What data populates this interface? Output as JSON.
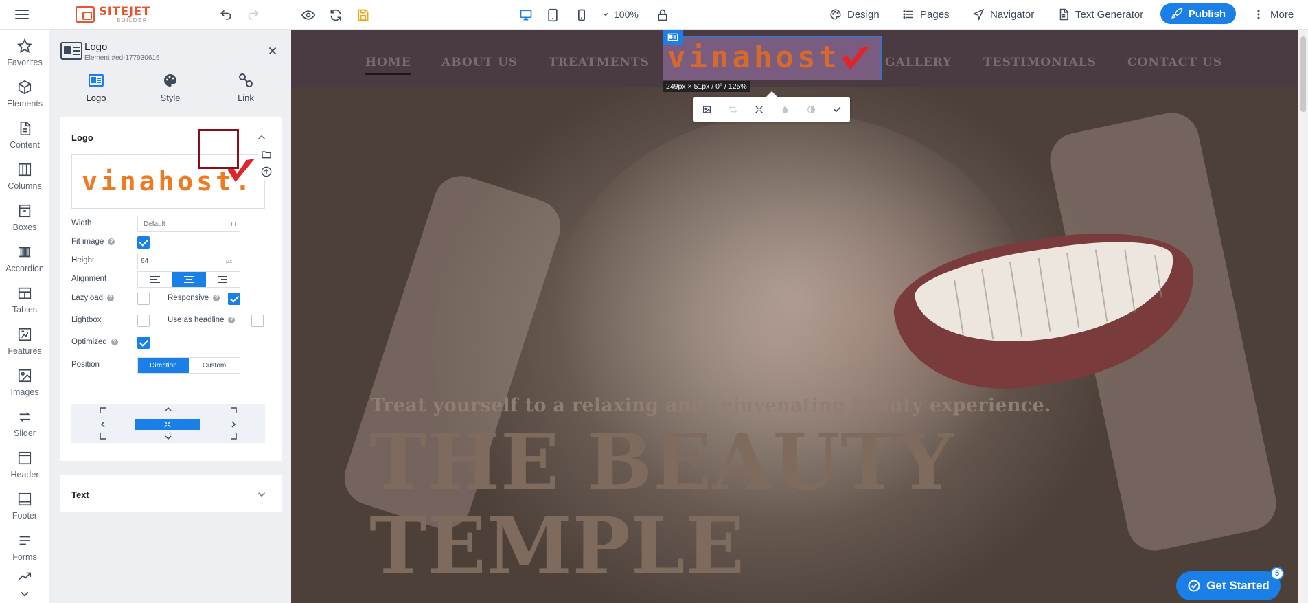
{
  "app": {
    "brand_line1": "SITEJET",
    "brand_line2": "BUILDER",
    "zoom": "100%",
    "nav": {
      "design": "Design",
      "pages": "Pages",
      "navigator": "Navigator",
      "text_generator": "Text Generator",
      "more": "More"
    },
    "publish_label": "Publish",
    "accent_color": "#1a7fe6",
    "brand_color": "#e8542c"
  },
  "rail": {
    "items": [
      {
        "label": "Favorites",
        "icon": "star-icon"
      },
      {
        "label": "Elements",
        "icon": "cube-icon"
      },
      {
        "label": "Content",
        "icon": "document-icon"
      },
      {
        "label": "Columns",
        "icon": "columns-icon"
      },
      {
        "label": "Boxes",
        "icon": "box-icon"
      },
      {
        "label": "Accordion",
        "icon": "accordion-icon"
      },
      {
        "label": "Tables",
        "icon": "table-icon"
      },
      {
        "label": "Features",
        "icon": "features-icon"
      },
      {
        "label": "Images",
        "icon": "image-icon"
      },
      {
        "label": "Slider",
        "icon": "slider-icon"
      },
      {
        "label": "Header",
        "icon": "header-icon"
      },
      {
        "label": "Footer",
        "icon": "footer-icon"
      },
      {
        "label": "Forms",
        "icon": "forms-icon"
      }
    ]
  },
  "panel": {
    "title": "Logo",
    "element_id": "Element #ed-177930616",
    "tabs": [
      {
        "label": "Logo",
        "icon": "logo-icon"
      },
      {
        "label": "Style",
        "icon": "palette-icon"
      },
      {
        "label": "Link",
        "icon": "link-icon"
      }
    ],
    "logo_section": {
      "title": "Logo",
      "logo_text": "vinahost.",
      "width_label": "Width",
      "width_value": "Default",
      "fit_image_label": "Fit image",
      "fit_image": true,
      "height_label": "Height",
      "height_value": "64",
      "height_unit": "px",
      "alignment_label": "Alignment",
      "alignment": "center",
      "lazyload_label": "Lazyload",
      "lazyload": false,
      "responsive_label": "Responsive",
      "responsive": true,
      "lightbox_label": "Lightbox",
      "lightbox": false,
      "use_as_headline_label": "Use as headline",
      "use_as_headline": false,
      "optimized_label": "Optimized",
      "optimized": true,
      "position_label": "Position",
      "position_options": [
        "Direction",
        "Custom"
      ],
      "position_selected": "Direction"
    },
    "text_section": {
      "title": "Text"
    }
  },
  "canvas": {
    "nav": [
      "HOME",
      "ABOUT US",
      "TREATMENTS",
      "GALLERY",
      "TESTIMONIALS",
      "CONTACT US"
    ],
    "logo_text": "vinahost.",
    "dimension_tip": "249px × 51px / 0° / 125%",
    "tagline": "Treat yourself to a relaxing and rejuvenating beauty experience.",
    "headline_line1": "THE BEAUTY",
    "headline_line2": "TEMPLE"
  },
  "get_started": {
    "label": "Get Started",
    "badge": "5"
  }
}
